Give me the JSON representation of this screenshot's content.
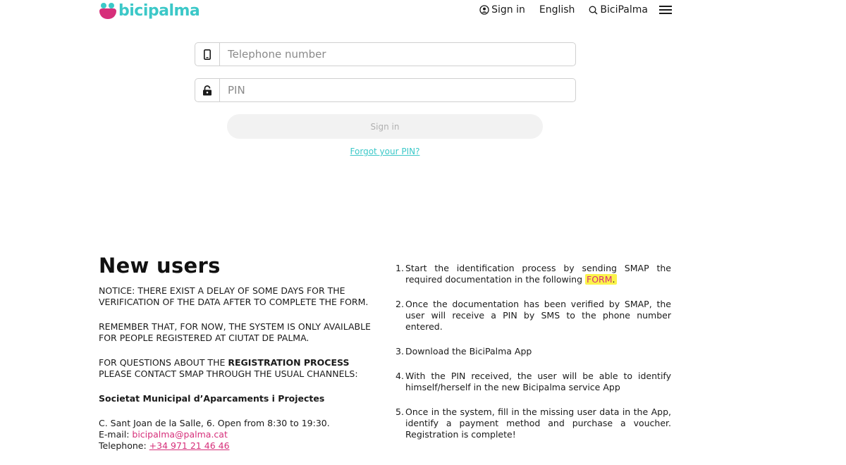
{
  "header": {
    "logo_text": "bicipalma",
    "nav": {
      "sign_in": "Sign in",
      "language": "English",
      "search": "BiciPalma"
    }
  },
  "login": {
    "telephone_placeholder": "Telephone number",
    "pin_placeholder": "PIN",
    "sign_in_button": "Sign in",
    "forgot_pin": "Forgot your PIN?"
  },
  "new_users": {
    "title": "New users",
    "notice": "NOTICE: THERE EXIST A DELAY OF SOME DAYS FOR THE VERIFICATION OF THE DATA AFTER TO COMPLETE THE FORM.",
    "remember": "REMEMBER THAT, FOR NOW, THE SYSTEM IS ONLY AVAILABLE FOR PEOPLE REGISTERED AT CIUTAT DE PALMA.",
    "questions_pre": "FOR QUESTIONS ABOUT THE ",
    "questions_strong": "REGISTRATION PROCESS",
    "questions_post": " PLEASE CONTACT SMAP THROUGH THE USUAL CHANNELS:",
    "company": "Societat Municipal d’Aparcaments i Projectes",
    "address": "C. Sant Joan de la Salle, 6. Open from 8:30 to 19:30.",
    "email_label": "E-mail: ",
    "email": "bicipalma@palma.cat",
    "phone_label": "Telephone: ",
    "phone": "+34 971 21 46 46"
  },
  "steps": {
    "s1_num": "1.",
    "s1_pre": "Start the identification process by sending SMAP the required documentation in the following ",
    "s1_link": "FORM",
    "s1_post": ".",
    "s2_num": "2.",
    "s2": "Once the documentation has been verified by SMAP, the user will receive a PIN by SMS to the phone number entered.",
    "s3_num": "3.",
    "s3": "Download the BiciPalma App",
    "s4_num": "4.",
    "s4": "With the PIN received, the user will be able to identify himself/herself in the new Bicipalma service App",
    "s5_num": "5.",
    "s5": "Once in the system, fill in the missing user data in the App, identify a payment method and purchase a voucher. Registration is complete!"
  },
  "colors": {
    "brand_teal": "#3cc8c8",
    "brand_pink": "#d62f7a",
    "highlight": "#fbf34a"
  }
}
